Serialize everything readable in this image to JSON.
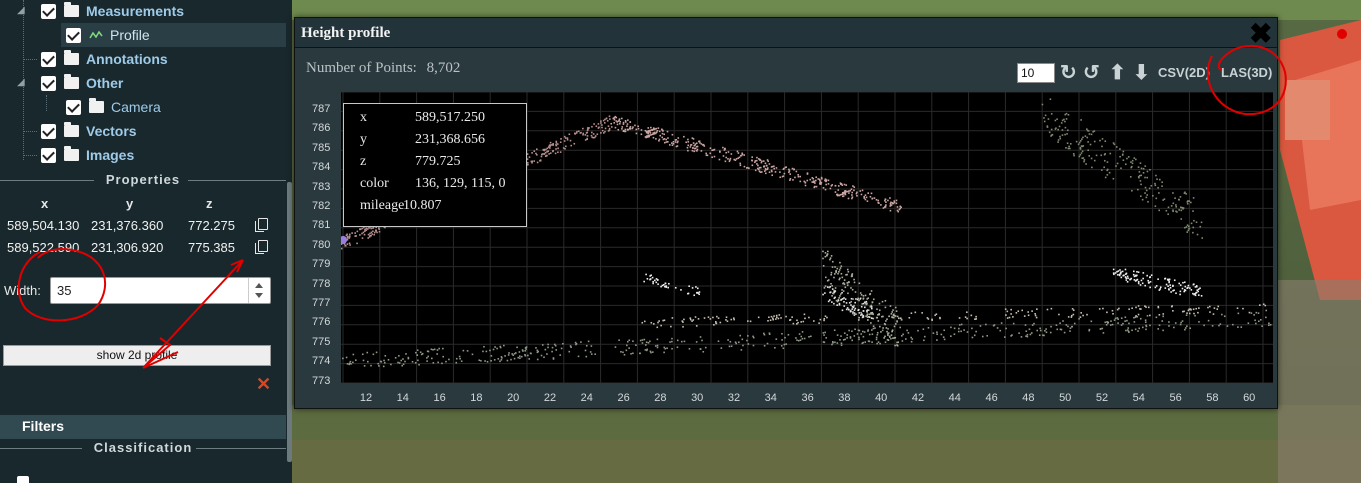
{
  "tree": {
    "measurements": "Measurements",
    "profile": "Profile",
    "annotations": "Annotations",
    "other": "Other",
    "camera": "Camera",
    "vectors": "Vectors",
    "images": "Images"
  },
  "properties": {
    "header": "Properties",
    "columns": [
      "x",
      "y",
      "z"
    ],
    "rows": [
      {
        "x": "589,504.130",
        "y": "231,376.360",
        "z": "772.275"
      },
      {
        "x": "589,522.590",
        "y": "231,306.920",
        "z": "775.385"
      }
    ],
    "width_label": "Width:",
    "width_value": "35",
    "show_profile_label": "show 2d profile",
    "remove_symbol": "✕"
  },
  "filters": {
    "label": "Filters",
    "classification_header": "Classification"
  },
  "height_profile": {
    "title": "Height profile",
    "points_label": "Number of Points:",
    "points_value": "8,702",
    "point_budget": "10",
    "csv_label": "CSV(2D)",
    "las_label": "LAS(3D)",
    "close_symbol": "✖",
    "tooltip": [
      {
        "key": "x",
        "value": "589,517.250"
      },
      {
        "key": "y",
        "value": "231,368.656"
      },
      {
        "key": "z",
        "value": "779.725"
      },
      {
        "key": "color",
        "value": "136, 129, 115, 0"
      },
      {
        "key": "mileage",
        "value": "10.807"
      }
    ],
    "y_ticks": [
      "787",
      "786",
      "785",
      "784",
      "783",
      "782",
      "781",
      "780",
      "779",
      "778",
      "777",
      "776",
      "775",
      "774",
      "773"
    ],
    "x_ticks": [
      "12",
      "14",
      "16",
      "18",
      "20",
      "22",
      "24",
      "26",
      "28",
      "30",
      "32",
      "34",
      "36",
      "38",
      "40",
      "42",
      "44",
      "46",
      "48",
      "50",
      "52",
      "54",
      "56",
      "58",
      "60"
    ]
  },
  "colors": {
    "sidebar_bg": "#19282c",
    "link_blue": "#9ecbe9",
    "annotation_red": "#e00000",
    "roof_points": "#b89a96",
    "ground_points": "#8f9b8a"
  }
}
